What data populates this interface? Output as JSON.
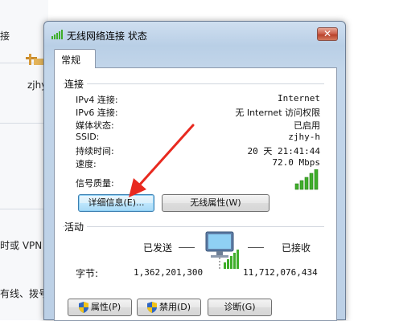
{
  "background_window": {
    "texts": [
      "接",
      "zjhy",
      "时或 VPN",
      "有线、拨号"
    ]
  },
  "dialog": {
    "title": "无线网络连接 状态",
    "close_label": "✕",
    "tab": "常规",
    "connection": {
      "section_label": "连接",
      "rows": [
        {
          "label": "IPv4 连接:",
          "value": "Internet"
        },
        {
          "label": "IPv6 连接:",
          "value": "无 Internet 访问权限"
        },
        {
          "label": "媒体状态:",
          "value": "已启用"
        },
        {
          "label": "SSID:",
          "value": "zjhy-h"
        },
        {
          "label": "持续时间:",
          "value": "20 天 21:41:44"
        },
        {
          "label": "速度:",
          "value": "72.0 Mbps"
        }
      ],
      "signal_label": "信号质量:",
      "signal_bars": 5,
      "details_button": "详细信息(E)...",
      "wireless_props_button": "无线属性(W)"
    },
    "activity": {
      "section_label": "活动",
      "sent_label": "已发送",
      "received_label": "已接收",
      "bytes_label": "字节:",
      "bytes_sent": "1,362,201,300",
      "bytes_received": "11,712,076,434"
    },
    "buttons": {
      "properties": "属性(P)",
      "disable": "禁用(D)",
      "diagnose": "诊断(G)"
    }
  },
  "colors": {
    "signal_green": "#3fae2a",
    "annotation_red": "#e8291f",
    "close_red": "#c95a45"
  }
}
